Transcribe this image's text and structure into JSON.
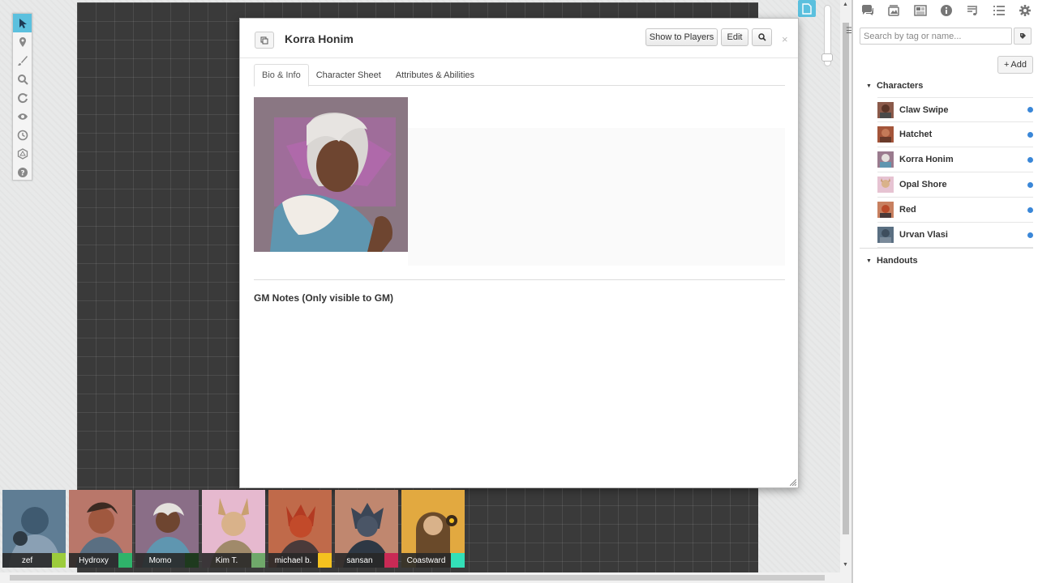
{
  "dialog": {
    "title": "Korra Honim",
    "buttons": {
      "show_to_players": "Show to Players",
      "edit": "Edit"
    },
    "tabs": [
      {
        "label": "Bio & Info",
        "active": true
      },
      {
        "label": "Character Sheet",
        "active": false
      },
      {
        "label": "Attributes & Abilities",
        "active": false
      }
    ],
    "gm_notes_heading": "GM Notes (Only visible to GM)",
    "close_glyph": "×"
  },
  "toolbar": {
    "tools": [
      {
        "icon": "select-arrow-icon",
        "active": true
      },
      {
        "icon": "map-pin-icon",
        "active": false
      },
      {
        "icon": "brush-icon",
        "active": false
      },
      {
        "icon": "zoom-icon",
        "active": false
      },
      {
        "icon": "refresh-icon",
        "active": false
      },
      {
        "icon": "eye-icon",
        "active": false
      },
      {
        "icon": "clock-icon",
        "active": false
      },
      {
        "icon": "d20-icon",
        "active": false
      },
      {
        "icon": "help-icon",
        "active": false
      }
    ]
  },
  "sidebar": {
    "icons": [
      "chat-icon",
      "art-library-icon",
      "journal-icon",
      "info-icon",
      "music-icon",
      "list-icon",
      "gear-icon"
    ],
    "search_placeholder": "Search by tag or name...",
    "add_label": "Add",
    "add_glyph": "+",
    "folders": {
      "characters": "Characters",
      "handouts": "Handouts"
    },
    "characters": [
      {
        "name": "Claw Swipe",
        "color": "#8b5a4a"
      },
      {
        "name": "Hatchet",
        "color": "#a4553a"
      },
      {
        "name": "Korra Honim",
        "color": "#9a7b8e"
      },
      {
        "name": "Opal Shore",
        "color": "#d8a8b8"
      },
      {
        "name": "Red",
        "color": "#b9553a"
      },
      {
        "name": "Urvan Vlasi",
        "color": "#5a6f82"
      }
    ],
    "status_dot_color": "#3a87d8"
  },
  "players": [
    {
      "name": "zef",
      "color": "#9ccc3c",
      "bg": "#5f7d94"
    },
    {
      "name": "Hydroxy",
      "color": "#2fb36a",
      "bg": "#b9776a"
    },
    {
      "name": "Momo",
      "color": "#1e3a1e",
      "bg": "#8a6e87"
    },
    {
      "name": "Kim T.",
      "color": "#6fa86a",
      "bg": "#e6b9cf"
    },
    {
      "name": "michael b.",
      "color": "#f5c21f",
      "bg": "#c06a4a"
    },
    {
      "name": "sansan",
      "color": "#c92a55",
      "bg": "#c0876f"
    },
    {
      "name": "Coastward",
      "color": "#33e0b8",
      "bg": "#e2a940"
    }
  ]
}
